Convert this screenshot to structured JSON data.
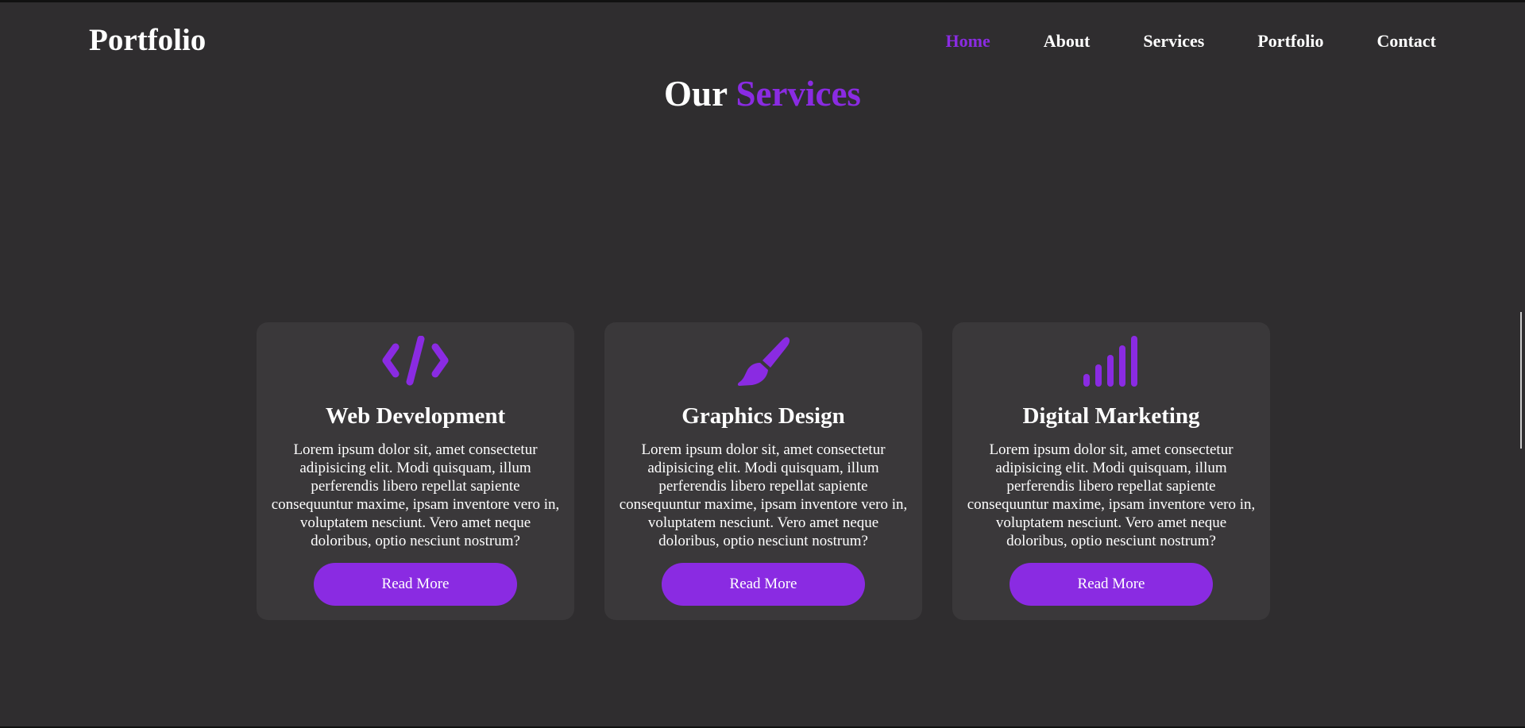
{
  "colors": {
    "accent": "#8a2be2",
    "background": "#2f2d2f",
    "card": "#3a383a",
    "text": "#ffffff"
  },
  "header": {
    "logo": "Portfolio",
    "nav": [
      {
        "label": "Home",
        "active": true
      },
      {
        "label": "About",
        "active": false
      },
      {
        "label": "Services",
        "active": false
      },
      {
        "label": "Portfolio",
        "active": false
      },
      {
        "label": "Contact",
        "active": false
      }
    ]
  },
  "services": {
    "title_prefix": "Our",
    "title_accent": "Services",
    "cards": [
      {
        "icon": "code-icon",
        "title": "Web Development",
        "text": "Lorem ipsum dolor sit, amet consectetur adipisicing elit. Modi quisquam, illum perferendis libero repellat sapiente consequuntur maxime, ipsam inventore vero in, voluptatem nesciunt. Vero amet neque doloribus, optio nesciunt nostrum?",
        "button": "Read More"
      },
      {
        "icon": "paintbrush-icon",
        "title": "Graphics Design",
        "text": "Lorem ipsum dolor sit, amet consectetur adipisicing elit. Modi quisquam, illum perferendis libero repellat sapiente consequuntur maxime, ipsam inventore vero in, voluptatem nesciunt. Vero amet neque doloribus, optio nesciunt nostrum?",
        "button": "Read More"
      },
      {
        "icon": "signal-bars-icon",
        "title": "Digital Marketing",
        "text": "Lorem ipsum dolor sit, amet consectetur adipisicing elit. Modi quisquam, illum perferendis libero repellat sapiente consequuntur maxime, ipsam inventore vero in, voluptatem nesciunt. Vero amet neque doloribus, optio nesciunt nostrum?",
        "button": "Read More"
      }
    ]
  }
}
